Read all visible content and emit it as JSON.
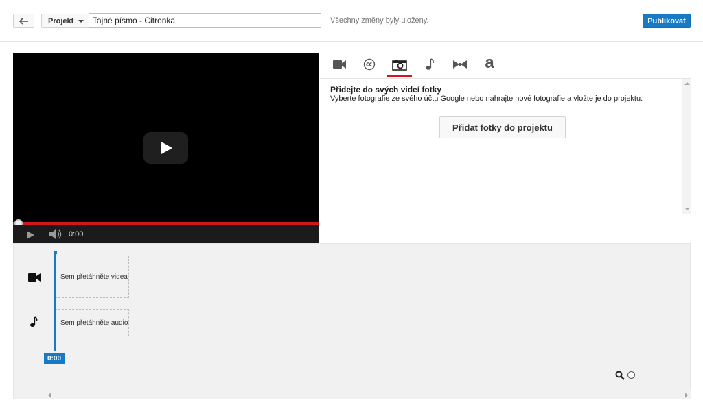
{
  "header": {
    "back_icon": "arrow-back-icon",
    "project_menu_label": "Projekt",
    "project_title_value": "Tajné písmo - Citronka",
    "saved_status": "Všechny změny byly uloženy.",
    "publish_label": "Publikovat",
    "accent_color": "#167ac6"
  },
  "player": {
    "time": "0:00",
    "progress_color": "#cc181e",
    "progress_fraction": 0,
    "icons": [
      "play-icon",
      "volume-icon"
    ]
  },
  "tabs": [
    {
      "name": "video-camera-icon",
      "active": false
    },
    {
      "name": "closed-captions-icon",
      "active": false
    },
    {
      "name": "camera-icon",
      "active": true
    },
    {
      "name": "music-note-icon",
      "active": false
    },
    {
      "name": "transitions-icon",
      "active": false
    },
    {
      "name": "text-icon",
      "label": "a",
      "active": false
    }
  ],
  "photos_panel": {
    "heading": "Přidejte do svých videí fotky",
    "description": "Vyberte fotografie ze svého účtu Google nebo nahrajte nové fotografie a vložte je do projektu.",
    "add_button_label": "Přidat fotky do projektu"
  },
  "timeline": {
    "video_drop_label": "Sem přetáhněte videa",
    "audio_drop_label": "Sem přetáhněte audio",
    "playhead_time": "0:00",
    "zoom_level": 0
  }
}
